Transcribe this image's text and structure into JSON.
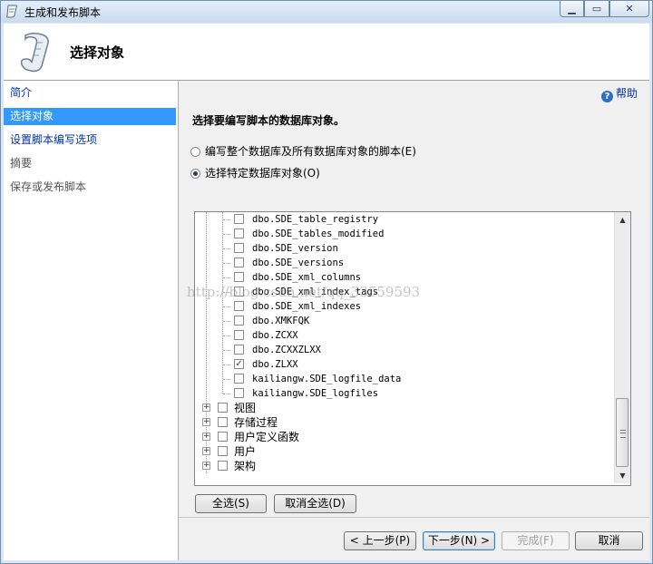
{
  "window": {
    "title": "生成和发布脚本"
  },
  "header": {
    "title": "选择对象"
  },
  "sidebar": {
    "items": [
      {
        "label": "简介",
        "state": "link"
      },
      {
        "label": "选择对象",
        "state": "selected"
      },
      {
        "label": "设置脚本编写选项",
        "state": "link"
      },
      {
        "label": "摘要",
        "state": "disabled"
      },
      {
        "label": "保存或发布脚本",
        "state": "disabled"
      }
    ]
  },
  "main": {
    "help_label": "帮助",
    "instruction": "选择要编写脚本的数据库对象。",
    "radio_all": "编写整个数据库及所有数据库对象的脚本(E)",
    "radio_specific": "选择特定数据库对象(O)",
    "tree_tables": [
      {
        "label": "dbo.SDE_table_registry",
        "checked": false
      },
      {
        "label": "dbo.SDE_tables_modified",
        "checked": false
      },
      {
        "label": "dbo.SDE_version",
        "checked": false
      },
      {
        "label": "dbo.SDE_versions",
        "checked": false
      },
      {
        "label": "dbo.SDE_xml_columns",
        "checked": false
      },
      {
        "label": "dbo.SDE_xml_index_tags",
        "checked": false
      },
      {
        "label": "dbo.SDE_xml_indexes",
        "checked": false
      },
      {
        "label": "dbo.XMKFQK",
        "checked": false
      },
      {
        "label": "dbo.ZCXX",
        "checked": false
      },
      {
        "label": "dbo.ZCXXZLXX",
        "checked": false
      },
      {
        "label": "dbo.ZLXX",
        "checked": true
      },
      {
        "label": "kailiangw.SDE_logfile_data",
        "checked": false
      },
      {
        "label": "kailiangw.SDE_logfiles",
        "checked": false
      }
    ],
    "tree_groups": [
      {
        "label": "视图"
      },
      {
        "label": "存储过程"
      },
      {
        "label": "用户定义函数"
      },
      {
        "label": "用户"
      },
      {
        "label": "架构"
      }
    ],
    "select_all": "全选(S)",
    "deselect_all": "取消全选(D)"
  },
  "footer": {
    "back": "< 上一步(P)",
    "next": "下一步(N) >",
    "finish": "完成(F)",
    "cancel": "取消"
  },
  "watermark": "http://blog.csdn.net/qq_33559593"
}
